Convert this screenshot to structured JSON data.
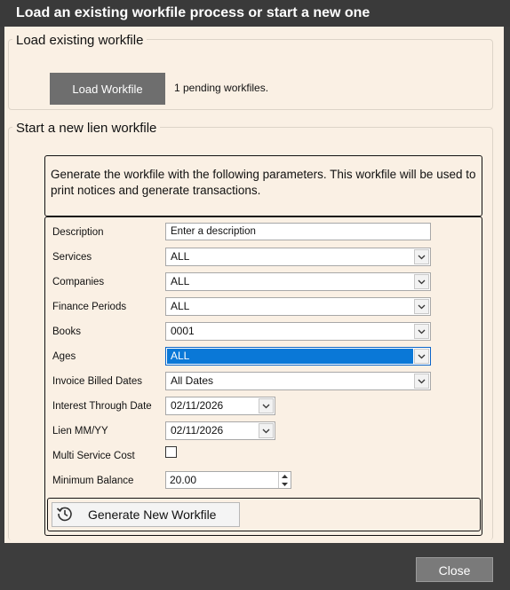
{
  "window": {
    "title": "Load an existing workfile process or start a new one"
  },
  "load_group": {
    "title": "Load existing workfile",
    "load_button": "Load Workfile",
    "pending_text": "1 pending workfiles."
  },
  "new_group": {
    "title": "Start a new lien workfile",
    "info_text": "Generate the workfile with the following parameters.   This workfile will be used to print notices and generate transactions.",
    "fields": {
      "description": {
        "label": "Description",
        "placeholder": "Enter a description"
      },
      "services": {
        "label": "Services",
        "value": "ALL"
      },
      "companies": {
        "label": "Companies",
        "value": "ALL"
      },
      "finance_periods": {
        "label": "Finance Periods",
        "value": "ALL"
      },
      "books": {
        "label": "Books",
        "value": "0001"
      },
      "ages": {
        "label": "Ages",
        "value": "ALL"
      },
      "invoice_billed_dates": {
        "label": "Invoice Billed Dates",
        "value": "All Dates"
      },
      "interest_through_date": {
        "label": "Interest Through Date",
        "value": "02/11/2026"
      },
      "lien_mmyy": {
        "label": "Lien MM/YY",
        "value": "02/11/2026"
      },
      "multi_service_cost": {
        "label": "Multi Service Cost",
        "checked": false
      },
      "minimum_balance": {
        "label": "Minimum Balance",
        "value": "20.00"
      }
    },
    "generate_button": {
      "label": "Generate New Workfile",
      "icon": "history-clock-icon"
    }
  },
  "footer": {
    "close_button": "Close"
  },
  "colors": {
    "panel_bg": "#faf0e4",
    "window_bg": "#3d3d3d",
    "selection": "#0a78d7"
  }
}
